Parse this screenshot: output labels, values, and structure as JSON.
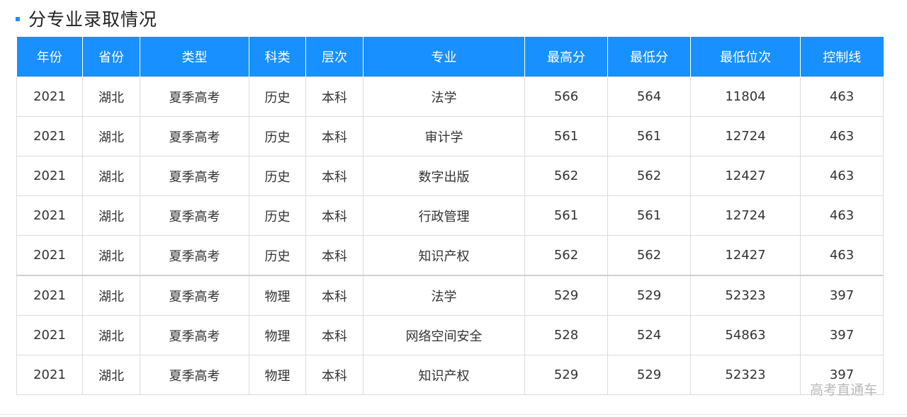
{
  "section": {
    "title": "分专业录取情况",
    "accent_color": "#1890ff"
  },
  "table": {
    "headers": [
      "年份",
      "省份",
      "类型",
      "科类",
      "层次",
      "专业",
      "最高分",
      "最低分",
      "最低位次",
      "控制线"
    ],
    "rows": [
      [
        "2021",
        "湖北",
        "夏季高考",
        "历史",
        "本科",
        "法学",
        "566",
        "564",
        "11804",
        "463"
      ],
      [
        "2021",
        "湖北",
        "夏季高考",
        "历史",
        "本科",
        "审计学",
        "561",
        "561",
        "12724",
        "463"
      ],
      [
        "2021",
        "湖北",
        "夏季高考",
        "历史",
        "本科",
        "数字出版",
        "562",
        "562",
        "12427",
        "463"
      ],
      [
        "2021",
        "湖北",
        "夏季高考",
        "历史",
        "本科",
        "行政管理",
        "561",
        "561",
        "12724",
        "463"
      ],
      [
        "2021",
        "湖北",
        "夏季高考",
        "历史",
        "本科",
        "知识产权",
        "562",
        "562",
        "12427",
        "463"
      ],
      [
        "2021",
        "湖北",
        "夏季高考",
        "物理",
        "本科",
        "法学",
        "529",
        "529",
        "52323",
        "397"
      ],
      [
        "2021",
        "湖北",
        "夏季高考",
        "物理",
        "本科",
        "网络空间安全",
        "528",
        "524",
        "54863",
        "397"
      ],
      [
        "2021",
        "湖北",
        "夏季高考",
        "物理",
        "本科",
        "知识产权",
        "529",
        "529",
        "52323",
        "397"
      ]
    ]
  },
  "watermark": "高考直通车"
}
